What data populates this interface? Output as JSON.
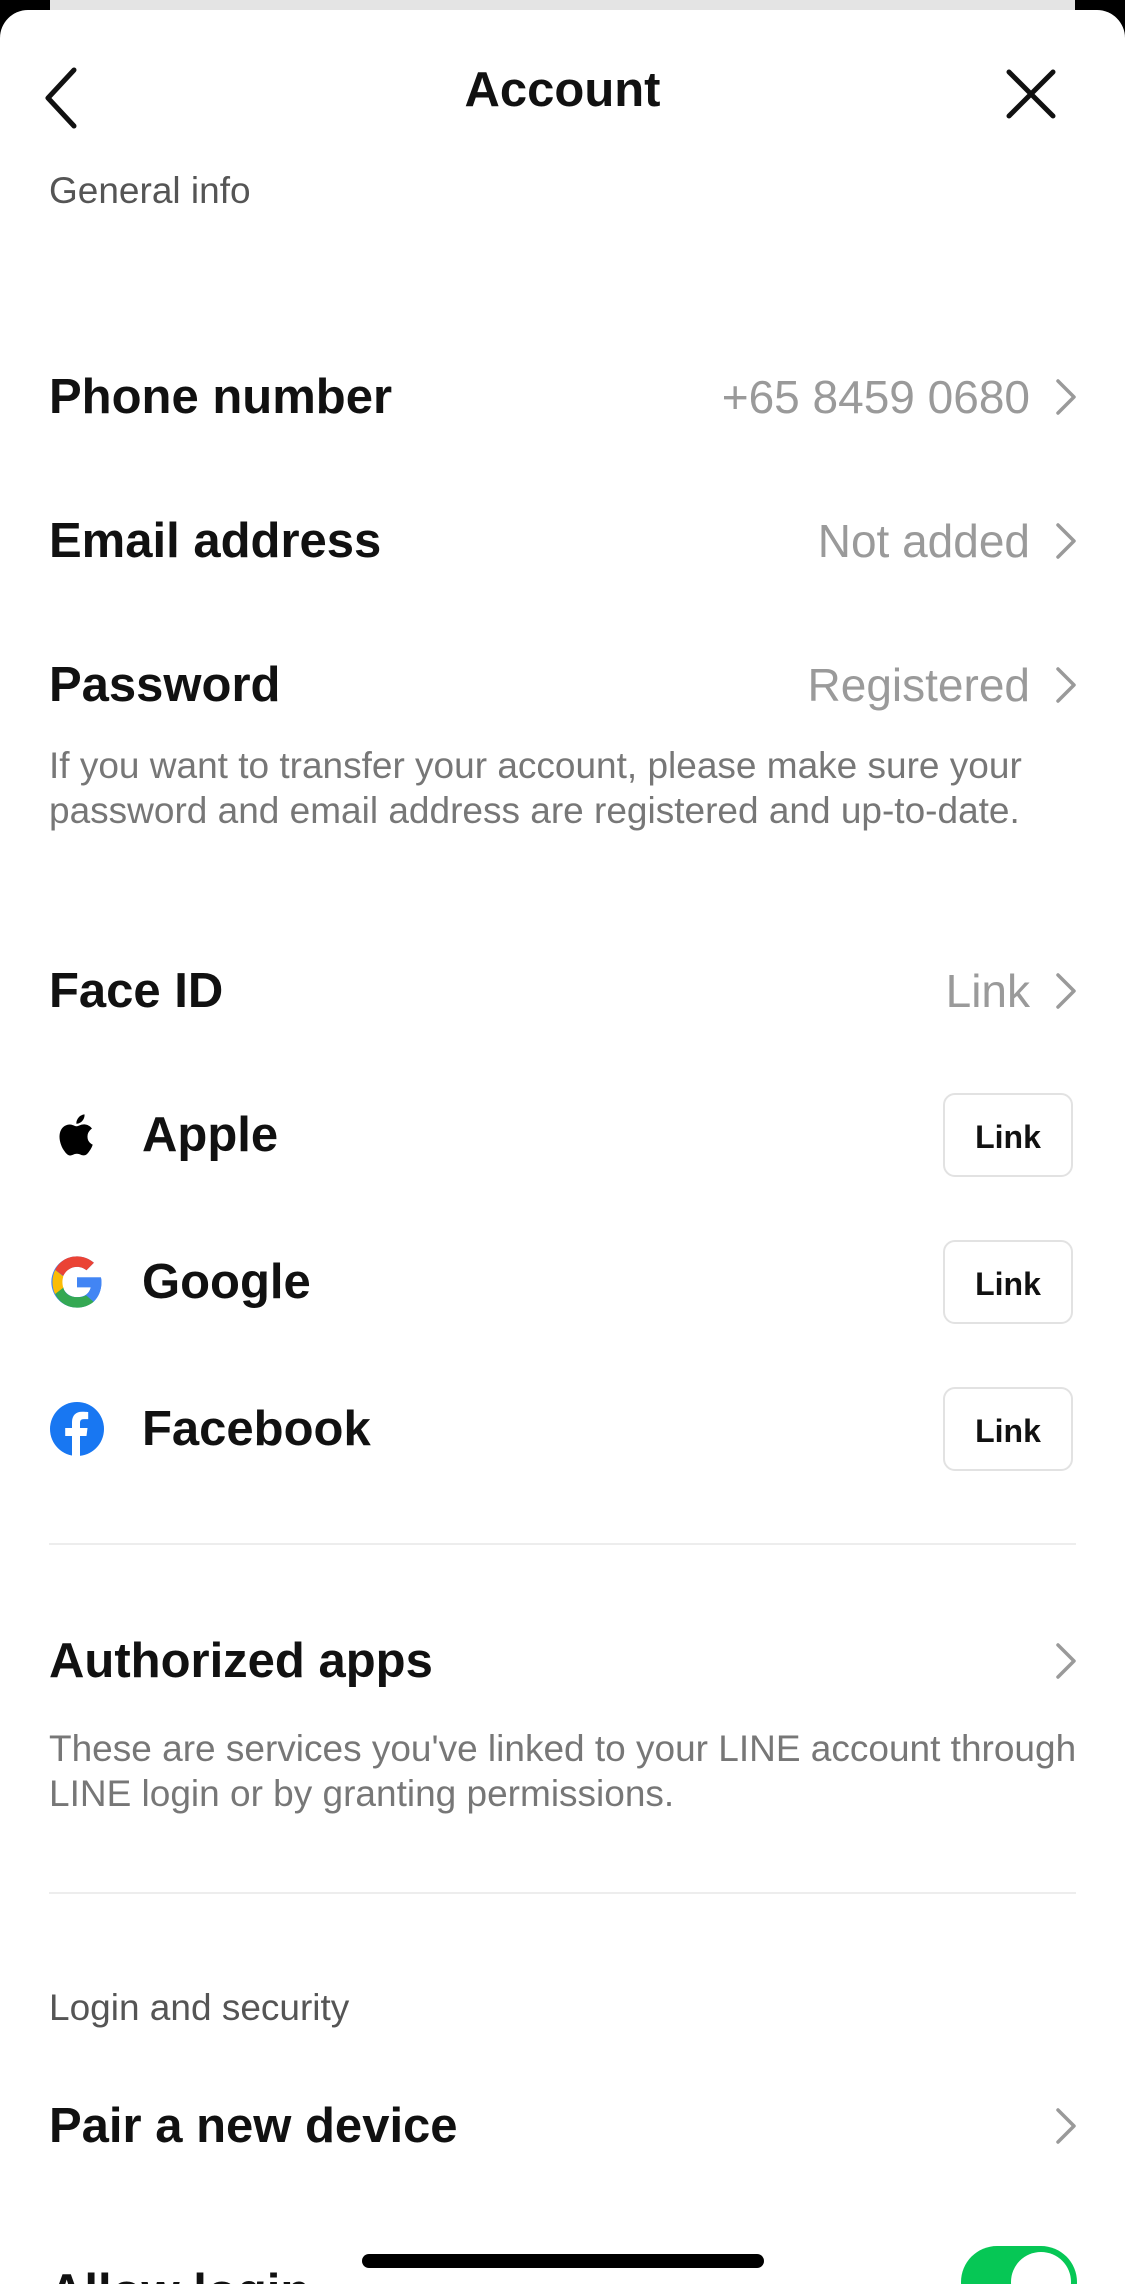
{
  "header": {
    "title": "Account"
  },
  "general_info": {
    "section_label": "General info",
    "phone": {
      "label": "Phone number",
      "value": "+65 8459 0680"
    },
    "email": {
      "label": "Email address",
      "value": "Not added"
    },
    "password": {
      "label": "Password",
      "value": "Registered",
      "description": "If you want to transfer your account, please make sure your password and email address are registered and up-to-date."
    },
    "face_id": {
      "label": "Face ID",
      "value": "Link"
    },
    "linked_accounts": [
      {
        "label": "Apple",
        "button": "Link",
        "icon": "apple-icon"
      },
      {
        "label": "Google",
        "button": "Link",
        "icon": "google-icon"
      },
      {
        "label": "Facebook",
        "button": "Link",
        "icon": "facebook-icon"
      }
    ]
  },
  "authorized_apps": {
    "label": "Authorized apps",
    "description": "These are services you've linked to your LINE account through LINE login or by granting permissions."
  },
  "login_security": {
    "section_label": "Login and security",
    "pair_device": {
      "label": "Pair a new device"
    },
    "allow_login": {
      "label": "Allow login",
      "enabled": true
    }
  },
  "colors": {
    "toggle_on": "#06c755",
    "facebook_blue": "#1877f2",
    "secondary_text": "#9a9a9a"
  }
}
